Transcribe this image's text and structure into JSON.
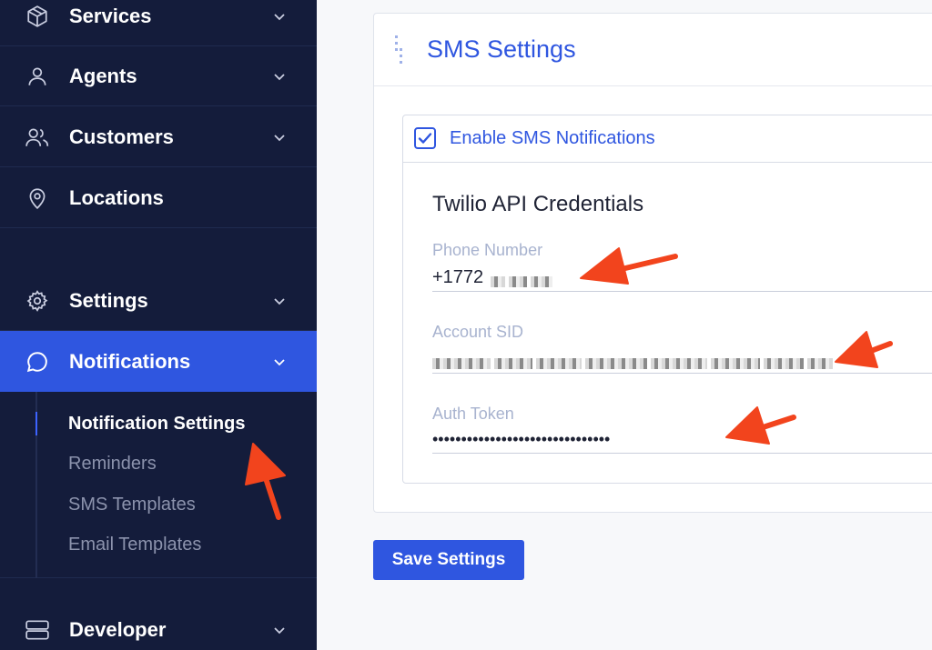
{
  "sidebar": {
    "items": [
      {
        "label": "Services",
        "icon": "box-icon"
      },
      {
        "label": "Agents",
        "icon": "user-icon"
      },
      {
        "label": "Customers",
        "icon": "users-icon"
      },
      {
        "label": "Locations",
        "icon": "map-pin-icon"
      },
      {
        "label": "Settings",
        "icon": "gear-icon"
      },
      {
        "label": "Notifications",
        "icon": "chat-bubble-icon"
      },
      {
        "label": "Developer",
        "icon": "server-icon"
      }
    ],
    "sub_items": [
      {
        "label": "Notification Settings"
      },
      {
        "label": "Reminders"
      },
      {
        "label": "SMS Templates"
      },
      {
        "label": "Email Templates"
      }
    ]
  },
  "card": {
    "title": "SMS Settings",
    "enable_label": "Enable SMS Notifications",
    "enabled": true,
    "section_title": "Twilio API Credentials",
    "fields": [
      {
        "label": "Phone Number",
        "value": "+1772"
      },
      {
        "label": "Account SID",
        "value": ""
      },
      {
        "label": "Auth Token",
        "value": "•••••••••••••••••••••••••••••••"
      }
    ]
  },
  "save_label": "Save Settings",
  "colors": {
    "sidebar_bg": "#141c3b",
    "accent": "#2f56e0",
    "annotation": "#f2441d"
  }
}
